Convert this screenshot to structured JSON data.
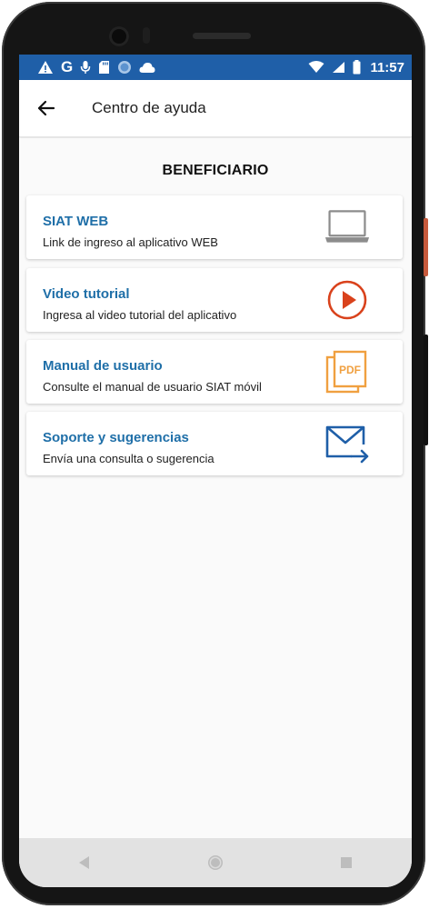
{
  "status_bar": {
    "time": "11:57",
    "left_icons": [
      "warning-icon",
      "google-icon",
      "mic-icon",
      "sd-card-icon",
      "circle-icon",
      "cloud-icon"
    ],
    "right_icons": [
      "wifi-icon",
      "signal-icon",
      "battery-icon"
    ],
    "color": "#1f5fa8"
  },
  "app_bar": {
    "title": "Centro de ayuda",
    "back_icon": "arrow-left-icon"
  },
  "section": {
    "title": "BENEFICIARIO"
  },
  "items": [
    {
      "title": "SIAT WEB",
      "description": "Link de ingreso al aplicativo WEB",
      "icon": "laptop-icon"
    },
    {
      "title": "Video tutorial",
      "description": "Ingresa al video tutorial del aplicativo",
      "icon": "play-circle-icon"
    },
    {
      "title": "Manual de usuario",
      "description": "Consulte el manual de usuario SIAT móvil",
      "icon": "pdf-icon",
      "icon_text": "PDF"
    },
    {
      "title": "Soporte y sugerencias",
      "description": "Envía una consulta o sugerencia",
      "icon": "mail-send-icon"
    }
  ],
  "colors": {
    "accent": "#1f6fa8",
    "play": "#d9421c",
    "pdf": "#f0a040",
    "laptop": "#8c8c8c",
    "mail": "#1f5fa8"
  },
  "nav_bar": {
    "buttons": [
      "back-triangle-icon",
      "home-circle-icon",
      "recents-square-icon"
    ]
  }
}
